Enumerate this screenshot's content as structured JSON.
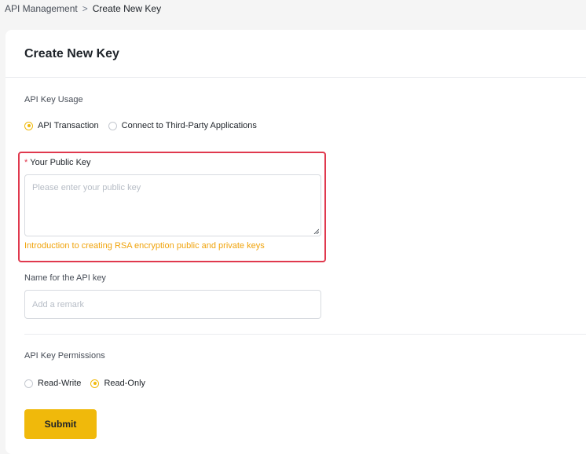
{
  "breadcrumb": {
    "parent": "API Management",
    "separator": ">",
    "current": "Create New Key"
  },
  "card": {
    "title": "Create New Key"
  },
  "usage": {
    "label": "API Key Usage",
    "options": [
      {
        "label": "API Transaction",
        "checked": true
      },
      {
        "label": "Connect to Third-Party Applications",
        "checked": false
      }
    ]
  },
  "public_key": {
    "required_mark": "*",
    "label": "Your Public Key",
    "placeholder": "Please enter your public key",
    "value": "",
    "help_link": "Introduction to creating RSA encryption public and private keys"
  },
  "name_field": {
    "label": "Name for the API key",
    "placeholder": "Add a remark",
    "value": ""
  },
  "permissions": {
    "label": "API Key Permissions",
    "options": [
      {
        "label": "Read-Write",
        "checked": false
      },
      {
        "label": "Read-Only",
        "checked": true
      }
    ]
  },
  "submit": {
    "label": "Submit"
  },
  "colors": {
    "accent": "#f0b90b",
    "link": "#f0a30b",
    "highlight": "#e0394e"
  }
}
